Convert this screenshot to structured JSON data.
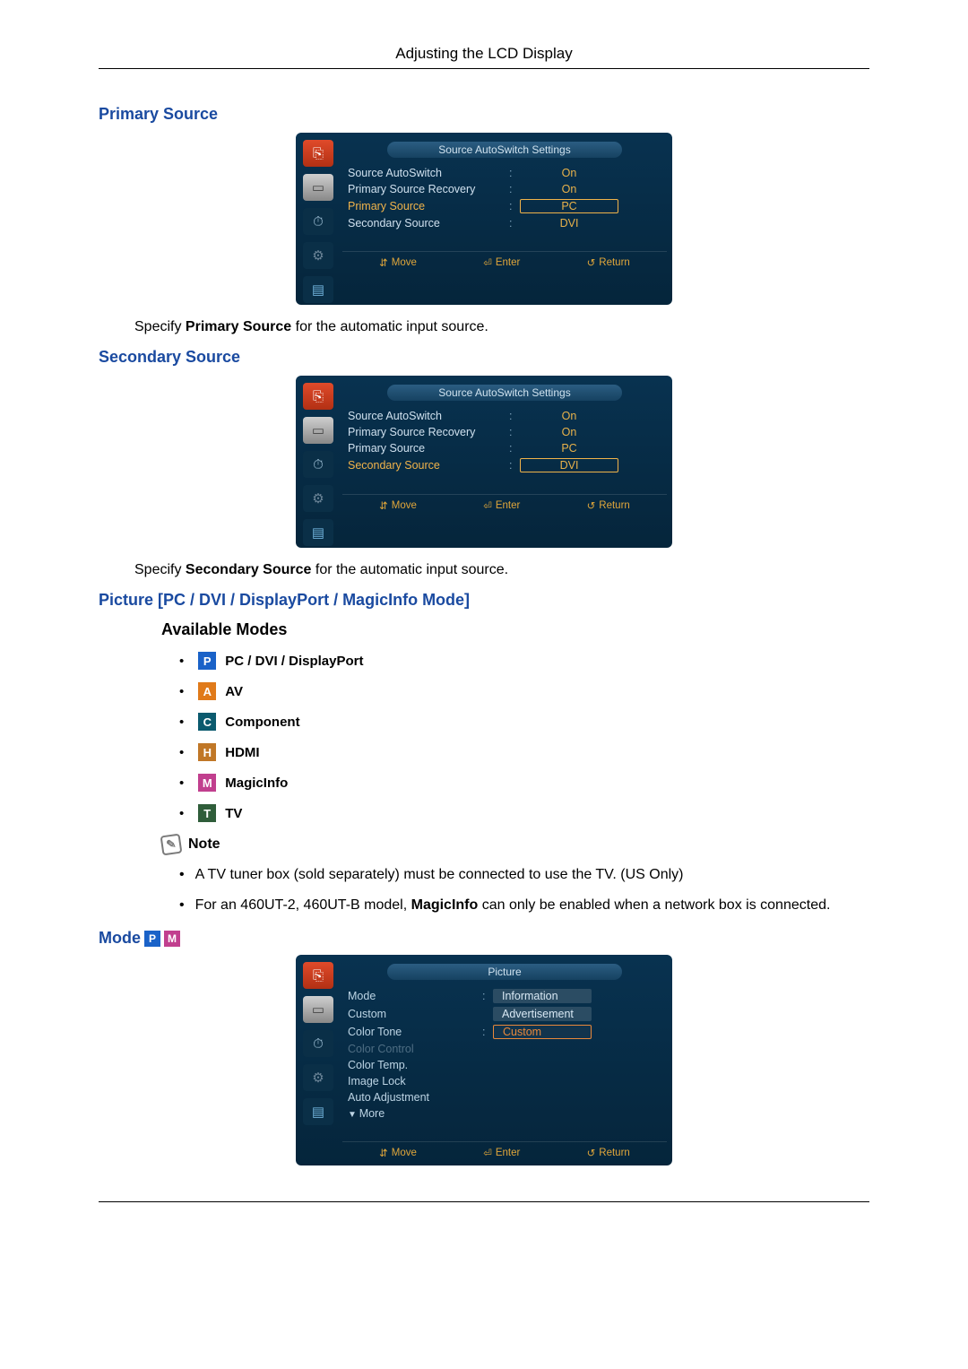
{
  "header": {
    "title": "Adjusting the LCD Display"
  },
  "primary": {
    "heading": "Primary Source",
    "desc_before": "Specify ",
    "desc_strong": "Primary Source",
    "desc_after": " for the automatic input source."
  },
  "secondary": {
    "heading": "Secondary Source",
    "desc_before": "Specify ",
    "desc_strong": "Secondary Source",
    "desc_after": " for the automatic input source."
  },
  "osd_sas": {
    "title": "Source AutoSwitch Settings",
    "rows": {
      "auto": {
        "label": "Source AutoSwitch",
        "value": "On"
      },
      "recovery": {
        "label": "Primary Source Recovery",
        "value": "On"
      },
      "primary": {
        "label": "Primary Source",
        "value": "PC"
      },
      "secondary": {
        "label": "Secondary Source",
        "value": "DVI"
      }
    },
    "footer": {
      "move": "Move",
      "enter": "Enter",
      "return": "Return"
    }
  },
  "picture_section": {
    "heading": "Picture [PC / DVI / DisplayPort / MagicInfo Mode]",
    "available": "Available Modes",
    "modes": [
      {
        "badge": "P",
        "cls": "blue",
        "label": "PC / DVI / DisplayPort"
      },
      {
        "badge": "A",
        "cls": "orange",
        "label": "AV"
      },
      {
        "badge": "C",
        "cls": "teal",
        "label": "Component"
      },
      {
        "badge": "H",
        "cls": "brown",
        "label": "HDMI"
      },
      {
        "badge": "M",
        "cls": "magenta",
        "label": "MagicInfo"
      },
      {
        "badge": "T",
        "cls": "olive",
        "label": "TV"
      }
    ],
    "note_label": "Note",
    "notes": {
      "n1": "A TV tuner box (sold separately) must be connected to use the TV. (US Only)",
      "n2_before": "For an 460UT-2, 460UT-B model, ",
      "n2_strong": "MagicInfo",
      "n2_after": " can only be enabled when a network box is connected."
    }
  },
  "mode": {
    "heading": "Mode",
    "badges": [
      {
        "badge": "P",
        "cls": "blue"
      },
      {
        "badge": "M",
        "cls": "magenta"
      }
    ]
  },
  "osd_picture": {
    "title": "Picture",
    "rows": {
      "mode": {
        "label": "Mode"
      },
      "custom": {
        "label": "Custom"
      },
      "colortone": {
        "label": "Color Tone"
      },
      "colorctrl": {
        "label": "Color Control"
      },
      "colortemp": {
        "label": "Color Temp."
      },
      "imagelock": {
        "label": "Image Lock"
      },
      "autoadj": {
        "label": "Auto Adjustment"
      },
      "more": {
        "label": "More"
      }
    },
    "values": {
      "info": "Information",
      "ad": "Advertisement",
      "custom": "Custom"
    },
    "footer": {
      "move": "Move",
      "enter": "Enter",
      "return": "Return"
    }
  }
}
